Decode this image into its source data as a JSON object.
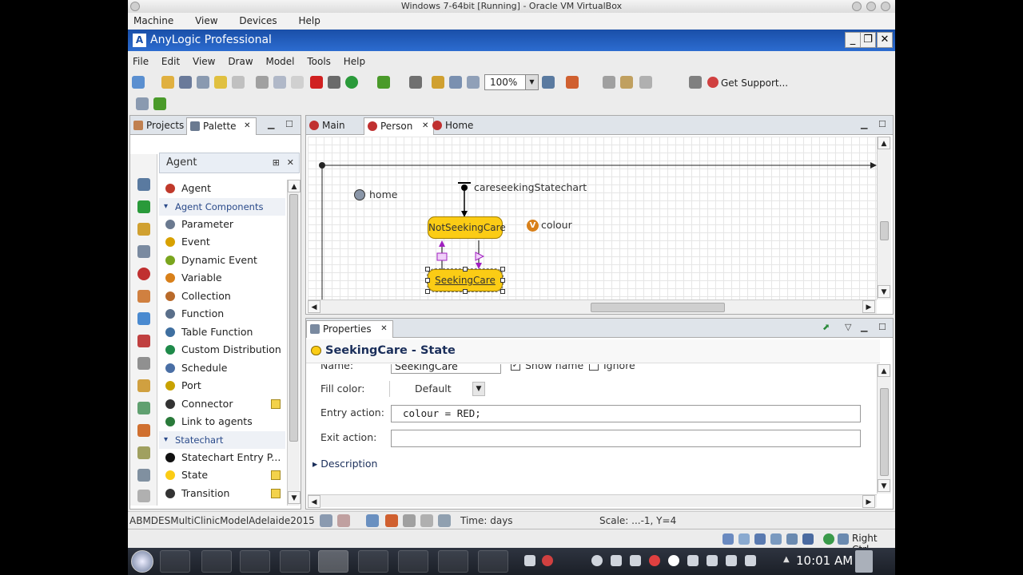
{
  "vbox": {
    "title": "Windows 7-64bit [Running] - Oracle VM VirtualBox",
    "menu": [
      "Machine",
      "View",
      "Devices",
      "Help"
    ],
    "right_ctrl": "Right Ctrl"
  },
  "app": {
    "title": "AnyLogic Professional",
    "menu": [
      "File",
      "Edit",
      "View",
      "Draw",
      "Model",
      "Tools",
      "Help"
    ],
    "zoom": "100%",
    "support": "Get Support..."
  },
  "left_panel": {
    "tabs": [
      "Projects",
      "Palette"
    ],
    "palette_title": "Agent",
    "items_top": [
      {
        "label": "Agent",
        "color": "#c0392b"
      }
    ],
    "group1": "Agent Components",
    "items_components": [
      {
        "label": "Parameter",
        "color": "#6b7a90"
      },
      {
        "label": "Event",
        "color": "#d8a100"
      },
      {
        "label": "Dynamic Event",
        "color": "#7aa51e"
      },
      {
        "label": "Variable",
        "color": "#d8801a"
      },
      {
        "label": "Collection",
        "color": "#b96a2a"
      },
      {
        "label": "Function",
        "color": "#5a6f8a"
      },
      {
        "label": "Table Function",
        "color": "#3f6fa0"
      },
      {
        "label": "Custom Distribution",
        "color": "#1f8a4a"
      },
      {
        "label": "Schedule",
        "color": "#4a6fa5"
      },
      {
        "label": "Port",
        "color": "#c8a200"
      },
      {
        "label": "Connector",
        "color": "#333333"
      },
      {
        "label": "Link to agents",
        "color": "#2a7a3a"
      }
    ],
    "group2": "Statechart",
    "items_statechart": [
      {
        "label": "Statechart Entry P...",
        "color": "#111111"
      },
      {
        "label": "State",
        "color": "#fbcc15"
      },
      {
        "label": "Transition",
        "color": "#333333"
      }
    ]
  },
  "editor": {
    "tabs": [
      "Main",
      "Person",
      "Home"
    ],
    "canvas": {
      "home_label": "home",
      "statechart_label": "careseekingStatechart",
      "variable_label": "colour",
      "state1": "NotSeekingCare",
      "state2": "SeekingCare"
    }
  },
  "properties": {
    "tab": "Properties",
    "title": "SeekingCare - State",
    "name_label": "Name:",
    "name_value": "SeekingCare",
    "show_name": "Show name",
    "ignore": "Ignore",
    "fill_label": "Fill color:",
    "fill_value": "Default",
    "entry_label": "Entry action:",
    "entry_value": "colour = RED;",
    "exit_label": "Exit action:",
    "exit_value": "",
    "description": "Description"
  },
  "status": {
    "project": "ABMDESMultiClinicModelAdelaide2015",
    "time": "Time: days",
    "scale": "Scale: ...-1, Y=4"
  },
  "taskbar": {
    "clock": "10:01 AM"
  }
}
